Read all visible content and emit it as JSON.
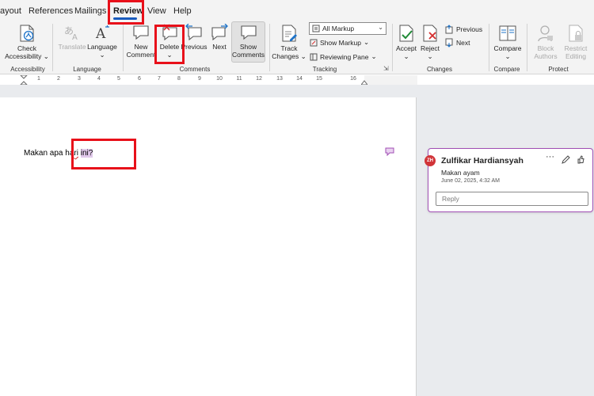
{
  "tabs": {
    "items": [
      "ayout",
      "References",
      "Mailings",
      "Review",
      "View",
      "Help"
    ],
    "active": "Review"
  },
  "ribbon": {
    "accessibility": {
      "check_line1": "Check",
      "check_line2": "Accessibility",
      "group": "Accessibility"
    },
    "language": {
      "translate": "Translate",
      "language": "Language",
      "group": "Language"
    },
    "comments": {
      "new_line1": "New",
      "new_line2": "Comment",
      "delete": "Delete",
      "previous": "Previous",
      "next": "Next",
      "show_line1": "Show",
      "show_line2": "Comments",
      "group": "Comments"
    },
    "tracking": {
      "track_line1": "Track",
      "track_line2": "Changes",
      "markup_select": "All Markup",
      "show_markup": "Show Markup",
      "reviewing_pane": "Reviewing Pane",
      "group": "Tracking"
    },
    "changes": {
      "accept": "Accept",
      "reject": "Reject",
      "previous": "Previous",
      "next": "Next",
      "group": "Changes"
    },
    "compare": {
      "compare": "Compare",
      "group": "Compare"
    },
    "protect": {
      "block_line1": "Block",
      "block_line2": "Authors",
      "restrict_line1": "Restrict",
      "restrict_line2": "Editing",
      "group": "Protect"
    }
  },
  "ruler": {
    "numbers": [
      "1",
      "2",
      "3",
      "4",
      "5",
      "6",
      "7",
      "8",
      "9",
      "10",
      "11",
      "12",
      "13",
      "14",
      "15",
      "16"
    ]
  },
  "document": {
    "text_before": "Makan apa ha",
    "text_squiggle": "ri",
    "text_highlighted": "ini?"
  },
  "comment": {
    "initials": "ZH",
    "author": "Zulfikar Hardiansyah",
    "body": "Makan ayam",
    "date": "June 02, 2025, 4:32 AM",
    "reply_placeholder": "Reply"
  },
  "colors": {
    "accent": "#185abd",
    "highlight_box": "#e8101a",
    "comment_border": "#a14fb5",
    "avatar": "#d13438"
  }
}
